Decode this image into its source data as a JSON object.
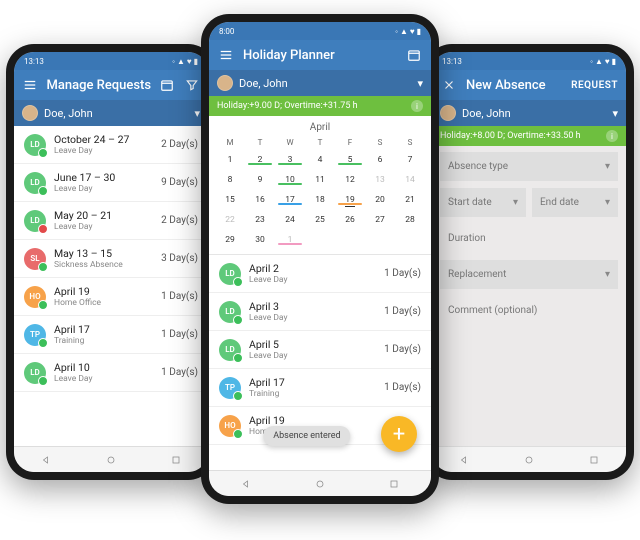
{
  "colors": {
    "ld": "#5fc97a",
    "sl": "#e86b6b",
    "ho": "#f7a24a",
    "tp": "#4fb7e6",
    "approved": "#3cbf5a",
    "denied": "#e24a4a",
    "pending": "#a0a0a0"
  },
  "left": {
    "time": "13:13",
    "title": "Manage Requests",
    "user": "Doe, John",
    "items": [
      {
        "code": "LD",
        "color": "ld",
        "status": "approved",
        "date": "October 24 – 27",
        "type": "Leave Day",
        "days": "2 Day(s)"
      },
      {
        "code": "LD",
        "color": "ld",
        "status": "approved",
        "date": "June 17 – 30",
        "type": "Leave Day",
        "days": "9 Day(s)"
      },
      {
        "code": "LD",
        "color": "ld",
        "status": "denied",
        "date": "May 20 – 21",
        "type": "Leave Day",
        "days": "2 Day(s)"
      },
      {
        "code": "SL",
        "color": "sl",
        "status": "approved",
        "date": "May 13 – 15",
        "type": "Sickness Absence",
        "days": "3 Day(s)"
      },
      {
        "code": "HO",
        "color": "ho",
        "status": "approved",
        "date": "April 19",
        "type": "Home Office",
        "days": "1 Day(s)"
      },
      {
        "code": "TP",
        "color": "tp",
        "status": "approved",
        "date": "April 17",
        "type": "Training",
        "days": "1 Day(s)"
      },
      {
        "code": "LD",
        "color": "ld",
        "status": "approved",
        "date": "April 10",
        "type": "Leave Day",
        "days": "1 Day(s)"
      }
    ]
  },
  "center": {
    "time": "8:00",
    "title": "Holiday Planner",
    "user": "Doe, John",
    "banner": "Holiday:+9.00 D; Overtime:+31.75 h",
    "month": "April",
    "weekdays": [
      "M",
      "T",
      "W",
      "T",
      "F",
      "S",
      "S"
    ],
    "weeks": [
      [
        {
          "n": "1",
          "bars": []
        },
        {
          "n": "2",
          "bars": [
            "g"
          ]
        },
        {
          "n": "3",
          "bars": [
            "g"
          ]
        },
        {
          "n": "4",
          "bars": []
        },
        {
          "n": "5",
          "bars": [
            "g"
          ]
        },
        {
          "n": "6",
          "bars": []
        },
        {
          "n": "7",
          "bars": []
        }
      ],
      [
        {
          "n": "8",
          "bars": []
        },
        {
          "n": "9",
          "bars": []
        },
        {
          "n": "10",
          "bars": [
            "g"
          ]
        },
        {
          "n": "11",
          "bars": []
        },
        {
          "n": "12",
          "bars": []
        },
        {
          "n": "13",
          "bars": [],
          "muted": true
        },
        {
          "n": "14",
          "bars": [],
          "muted": true
        }
      ],
      [
        {
          "n": "15",
          "bars": []
        },
        {
          "n": "16",
          "bars": []
        },
        {
          "n": "17",
          "bars": [
            "b"
          ]
        },
        {
          "n": "18",
          "bars": []
        },
        {
          "n": "19",
          "bars": [
            "o"
          ],
          "today": true
        },
        {
          "n": "20",
          "bars": []
        },
        {
          "n": "21",
          "bars": []
        }
      ],
      [
        {
          "n": "22",
          "bars": [],
          "muted": true
        },
        {
          "n": "23",
          "bars": []
        },
        {
          "n": "24",
          "bars": []
        },
        {
          "n": "25",
          "bars": []
        },
        {
          "n": "26",
          "bars": []
        },
        {
          "n": "27",
          "bars": []
        },
        {
          "n": "28",
          "bars": []
        }
      ],
      [
        {
          "n": "29",
          "bars": []
        },
        {
          "n": "30",
          "bars": []
        },
        {
          "n": "1",
          "bars": [
            "p"
          ],
          "muted": true
        },
        {
          "n": "",
          "bars": []
        },
        {
          "n": "",
          "bars": []
        },
        {
          "n": "",
          "bars": []
        },
        {
          "n": "",
          "bars": []
        }
      ]
    ],
    "items": [
      {
        "code": "LD",
        "color": "ld",
        "status": "approved",
        "date": "April 2",
        "type": "Leave Day",
        "days": "1 Day(s)"
      },
      {
        "code": "LD",
        "color": "ld",
        "status": "approved",
        "date": "April 3",
        "type": "Leave Day",
        "days": "1 Day(s)"
      },
      {
        "code": "LD",
        "color": "ld",
        "status": "approved",
        "date": "April 5",
        "type": "Leave Day",
        "days": "1 Day(s)"
      },
      {
        "code": "TP",
        "color": "tp",
        "status": "approved",
        "date": "April 17",
        "type": "Training",
        "days": "1 Day(s)"
      },
      {
        "code": "HO",
        "color": "ho",
        "status": "approved",
        "date": "April 19",
        "type": "Home Off…",
        "days": ""
      }
    ],
    "toast": "Absence entered"
  },
  "right": {
    "time": "13:13",
    "title": "New Absence",
    "action": "REQUEST",
    "user": "Doe, John",
    "banner": "Holiday:+8.00 D; Overtime:+33.50 h",
    "fields": {
      "absence_type": "Absence type",
      "start_date": "Start date",
      "end_date": "End date",
      "duration": "Duration",
      "replacement": "Replacement",
      "comment": "Comment (optional)"
    }
  }
}
